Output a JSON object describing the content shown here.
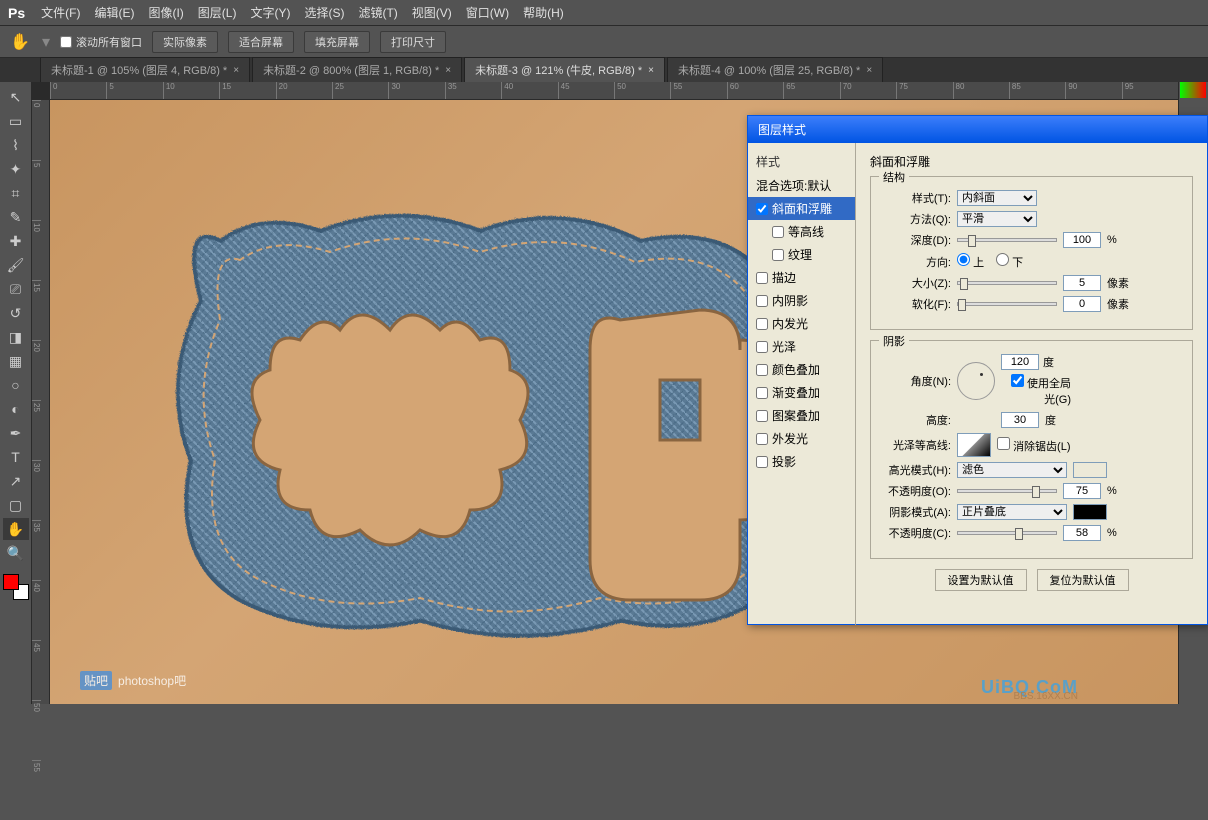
{
  "app": {
    "name": "Ps"
  },
  "menu": {
    "file": "文件(F)",
    "edit": "编辑(E)",
    "image": "图像(I)",
    "layer": "图层(L)",
    "type": "文字(Y)",
    "select": "选择(S)",
    "filter": "滤镜(T)",
    "view": "视图(V)",
    "window": "窗口(W)",
    "help": "帮助(H)"
  },
  "options": {
    "scroll_all": "滚动所有窗口",
    "actual_pixels": "实际像素",
    "fit_screen": "适合屏幕",
    "fill_screen": "填充屏幕",
    "print_size": "打印尺寸"
  },
  "tabs": [
    "未标题-1 @ 105% (图层 4, RGB/8) *",
    "未标题-2 @ 800% (图层 1, RGB/8) *",
    "未标题-3 @ 121% (牛皮, RGB/8) *",
    "未标题-4 @ 100% (图层 25, RGB/8) *"
  ],
  "active_tab": 2,
  "ruler_h": [
    "0",
    "5",
    "10",
    "15",
    "20",
    "25",
    "30",
    "35",
    "40",
    "45",
    "50",
    "55",
    "60",
    "65",
    "70",
    "75",
    "80",
    "85",
    "90",
    "95"
  ],
  "ruler_v": [
    "0",
    "5",
    "10",
    "15",
    "20",
    "25",
    "30",
    "35",
    "40",
    "45",
    "50",
    "55"
  ],
  "dialog": {
    "title": "图层样式",
    "list_header": "样式",
    "blend_options": "混合选项:默认",
    "effects": {
      "bevel": "斜面和浮雕",
      "contour": "等高线",
      "texture": "纹理",
      "stroke": "描边",
      "inner_shadow": "内阴影",
      "inner_glow": "内发光",
      "satin": "光泽",
      "color_overlay": "颜色叠加",
      "gradient_overlay": "渐变叠加",
      "pattern_overlay": "图案叠加",
      "outer_glow": "外发光",
      "drop_shadow": "投影"
    },
    "panel": {
      "title": "斜面和浮雕",
      "structure": "结构",
      "style_label": "样式(T):",
      "style_value": "内斜面",
      "technique_label": "方法(Q):",
      "technique_value": "平滑",
      "depth_label": "深度(D):",
      "depth_value": "100",
      "depth_unit": "%",
      "direction_label": "方向:",
      "direction_up": "上",
      "direction_down": "下",
      "size_label": "大小(Z):",
      "size_value": "5",
      "size_unit": "像素",
      "soften_label": "软化(F):",
      "soften_value": "0",
      "soften_unit": "像素",
      "shading": "阴影",
      "angle_label": "角度(N):",
      "angle_value": "120",
      "angle_unit": "度",
      "global_light": "使用全局光(G)",
      "altitude_label": "高度:",
      "altitude_value": "30",
      "altitude_unit": "度",
      "gloss_label": "光泽等高线:",
      "antialias": "消除锯齿(L)",
      "highlight_mode_label": "高光模式(H):",
      "highlight_mode_value": "滤色",
      "highlight_opacity_label": "不透明度(O):",
      "highlight_opacity_value": "75",
      "highlight_opacity_unit": "%",
      "shadow_mode_label": "阴影模式(A):",
      "shadow_mode_value": "正片叠底",
      "shadow_opacity_label": "不透明度(C):",
      "shadow_opacity_value": "58",
      "shadow_opacity_unit": "%",
      "set_default": "设置为默认值",
      "reset_default": "复位为默认值"
    }
  },
  "watermark": {
    "tieba": "贴吧",
    "author": "photoshop吧",
    "site": "UiBQ.CoM",
    "bbs": "BBS.16XX.CN"
  },
  "colors": {
    "highlight": "#ffffff",
    "shadow": "#000000"
  }
}
